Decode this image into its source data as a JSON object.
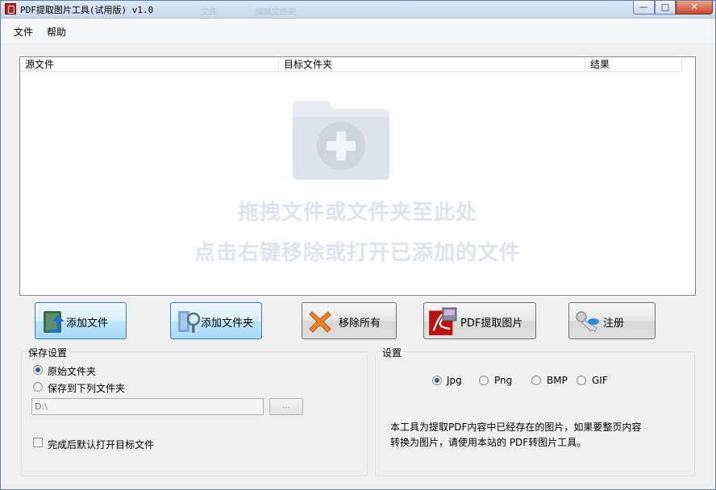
{
  "window": {
    "title": "PDF提取图片工具(试用版) v1.0",
    "ghost_tab_1": "文件",
    "ghost_tab_2": "编辑文件夹",
    "min_glyph": "—",
    "max_glyph": "□",
    "close_glyph": "✕"
  },
  "menu": {
    "items": [
      {
        "label": "文件"
      },
      {
        "label": "帮助"
      }
    ]
  },
  "file_list": {
    "columns": [
      {
        "label": "源文件"
      },
      {
        "label": "目标文件夹"
      },
      {
        "label": "结果"
      }
    ],
    "rows": [],
    "drop_hint_line1": "拖拽文件或文件夹至此处",
    "drop_hint_line2": "点击右键移除或打开已添加的文件"
  },
  "toolbar": {
    "add_file_label": "添加文件",
    "add_folder_label": "添加文件夹",
    "remove_all_label": "移除所有",
    "extract_label": "PDF提取图片",
    "register_label": "注册"
  },
  "save_settings": {
    "title": "保存设置",
    "option_original": "原始文件夹",
    "option_custom": "保存到下列文件夹",
    "selected": "original",
    "path_value": "D:\\",
    "browse_label": "...",
    "open_after_label": "完成后默认打开目标文件",
    "open_after_checked": false
  },
  "settings": {
    "title": "设置",
    "formats": [
      {
        "label": "Jpg",
        "selected": true
      },
      {
        "label": "Png",
        "selected": false
      },
      {
        "label": "BMP",
        "selected": false
      },
      {
        "label": "GIF",
        "selected": false
      }
    ],
    "description": "本工具为提取PDF内容中已经存在的图片，如果要整页内容\n转换为图片，请使用本站的 PDF转图片工具。"
  },
  "colors": {
    "accent": "#3c7fb1",
    "close_button": "#c74a33",
    "hint_text": "#dfe4ec"
  }
}
